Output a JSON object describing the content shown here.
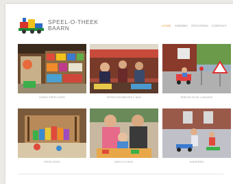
{
  "site": {
    "title_line1": "SPEEL-O-THEEK",
    "title_line2": "BAARN"
  },
  "nav": {
    "items": [
      {
        "label": "HOME",
        "active": true
      },
      {
        "label": "AGENDA",
        "active": false
      },
      {
        "label": "STICHTING",
        "active": false
      },
      {
        "label": "CONTACT",
        "active": false
      }
    ]
  },
  "gallery": {
    "items": [
      {
        "caption": "LENEN SPEELGOED"
      },
      {
        "caption": "SPEELGOEDBEURS 2 NOV"
      },
      {
        "caption": "SPELEN IN DE LUSHOEK"
      },
      {
        "caption": "SPEELGOED"
      },
      {
        "caption": "BIRGIT/LOEKE"
      },
      {
        "caption": "KINDEREN"
      }
    ]
  },
  "colors": {
    "accent": "#e8a24a",
    "text_muted": "#9a9a9a",
    "brand_text": "#6a6a6a"
  }
}
